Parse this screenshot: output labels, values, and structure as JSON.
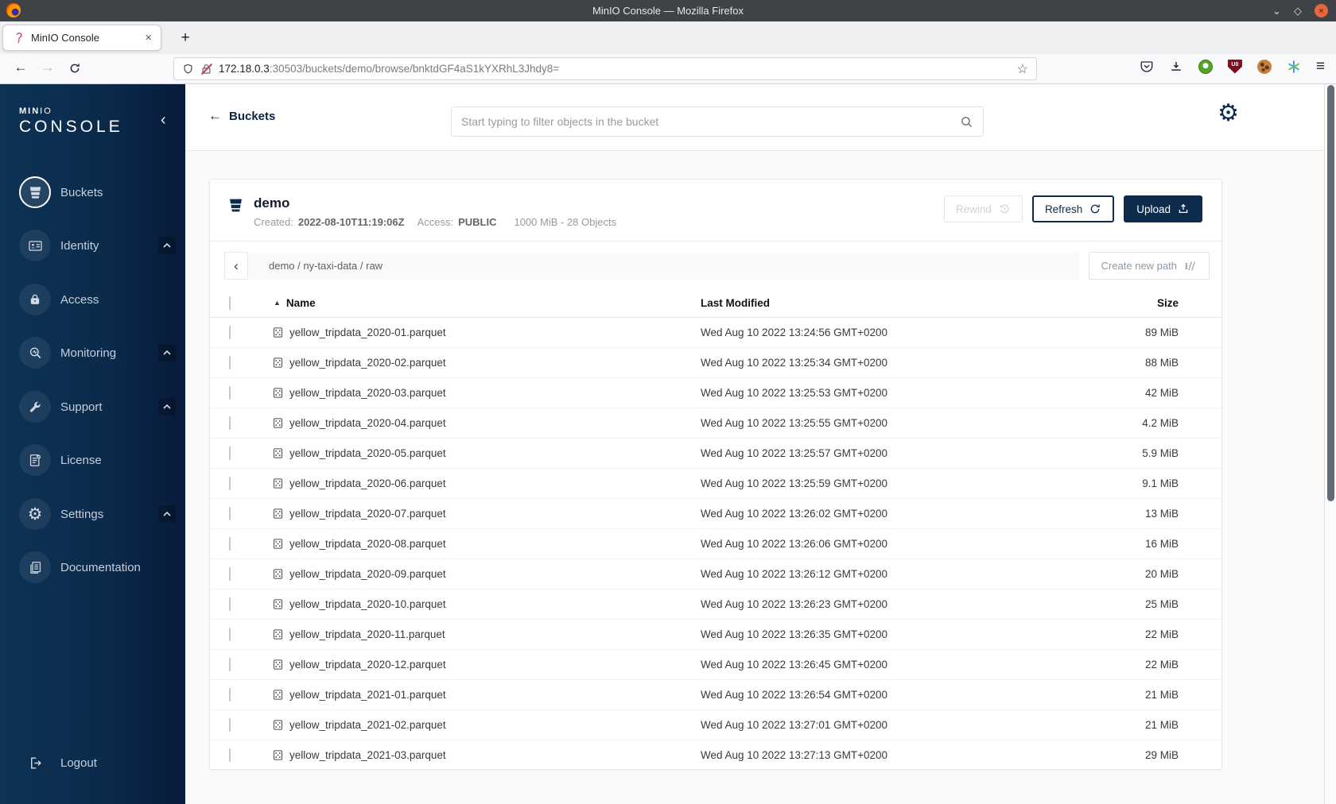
{
  "browser": {
    "window_title": "MinIO Console — Mozilla Firefox",
    "tab_title": "MinIO Console",
    "new_tab_label": "+",
    "url_host": "172.18.0.3",
    "url_rest": ":30503/buckets/demo/browse/bnktdGF4aS1kYXRhL3Jhdy8="
  },
  "icons": {
    "minimize": "⌄",
    "maximize": "◇",
    "close": "×",
    "back_arrow": "←",
    "forward_arrow": "→",
    "star": "☆",
    "menu": "≡",
    "collapse_chevron": "‹",
    "breadcrumb_chevron": "‹",
    "sort_asc": "▲",
    "gear": "⚙"
  },
  "sidebar": {
    "logo": {
      "part1": "MIN",
      "part2": "IO",
      "line2": "CONSOLE"
    },
    "items": [
      {
        "label": "Buckets"
      },
      {
        "label": "Identity"
      },
      {
        "label": "Access"
      },
      {
        "label": "Monitoring"
      },
      {
        "label": "Support"
      },
      {
        "label": "License"
      },
      {
        "label": "Settings"
      },
      {
        "label": "Documentation"
      }
    ],
    "logout_label": "Logout"
  },
  "header": {
    "back_label": "Buckets",
    "search_placeholder": "Start typing to filter objects in the bucket"
  },
  "bucket": {
    "name": "demo",
    "created_label": "Created:",
    "created_value": "2022-08-10T11:19:06Z",
    "access_label": "Access:",
    "access_value": "PUBLIC",
    "summary": "1000 MiB - 28 Objects",
    "actions": {
      "rewind": "Rewind",
      "refresh": "Refresh",
      "upload": "Upload"
    }
  },
  "path_bar": {
    "breadcrumb": "demo / ny-taxi-data / raw",
    "create_path_label": "Create new path"
  },
  "table": {
    "columns": {
      "name": "Name",
      "modified": "Last Modified",
      "size": "Size"
    },
    "rows": [
      {
        "name": "yellow_tripdata_2020-01.parquet",
        "modified": "Wed Aug 10 2022 13:24:56 GMT+0200",
        "size": "89 MiB"
      },
      {
        "name": "yellow_tripdata_2020-02.parquet",
        "modified": "Wed Aug 10 2022 13:25:34 GMT+0200",
        "size": "88 MiB"
      },
      {
        "name": "yellow_tripdata_2020-03.parquet",
        "modified": "Wed Aug 10 2022 13:25:53 GMT+0200",
        "size": "42 MiB"
      },
      {
        "name": "yellow_tripdata_2020-04.parquet",
        "modified": "Wed Aug 10 2022 13:25:55 GMT+0200",
        "size": "4.2 MiB"
      },
      {
        "name": "yellow_tripdata_2020-05.parquet",
        "modified": "Wed Aug 10 2022 13:25:57 GMT+0200",
        "size": "5.9 MiB"
      },
      {
        "name": "yellow_tripdata_2020-06.parquet",
        "modified": "Wed Aug 10 2022 13:25:59 GMT+0200",
        "size": "9.1 MiB"
      },
      {
        "name": "yellow_tripdata_2020-07.parquet",
        "modified": "Wed Aug 10 2022 13:26:02 GMT+0200",
        "size": "13 MiB"
      },
      {
        "name": "yellow_tripdata_2020-08.parquet",
        "modified": "Wed Aug 10 2022 13:26:06 GMT+0200",
        "size": "16 MiB"
      },
      {
        "name": "yellow_tripdata_2020-09.parquet",
        "modified": "Wed Aug 10 2022 13:26:12 GMT+0200",
        "size": "20 MiB"
      },
      {
        "name": "yellow_tripdata_2020-10.parquet",
        "modified": "Wed Aug 10 2022 13:26:23 GMT+0200",
        "size": "25 MiB"
      },
      {
        "name": "yellow_tripdata_2020-11.parquet",
        "modified": "Wed Aug 10 2022 13:26:35 GMT+0200",
        "size": "22 MiB"
      },
      {
        "name": "yellow_tripdata_2020-12.parquet",
        "modified": "Wed Aug 10 2022 13:26:45 GMT+0200",
        "size": "22 MiB"
      },
      {
        "name": "yellow_tripdata_2021-01.parquet",
        "modified": "Wed Aug 10 2022 13:26:54 GMT+0200",
        "size": "21 MiB"
      },
      {
        "name": "yellow_tripdata_2021-02.parquet",
        "modified": "Wed Aug 10 2022 13:27:01 GMT+0200",
        "size": "21 MiB"
      },
      {
        "name": "yellow_tripdata_2021-03.parquet",
        "modified": "Wed Aug 10 2022 13:27:13 GMT+0200",
        "size": "29 MiB"
      }
    ]
  },
  "colors": {
    "accent_navy": "#0c2b4d",
    "sidebar_start": "#0d3355",
    "sidebar_end": "#081b3a",
    "upload_button": "#0c2b4d"
  }
}
